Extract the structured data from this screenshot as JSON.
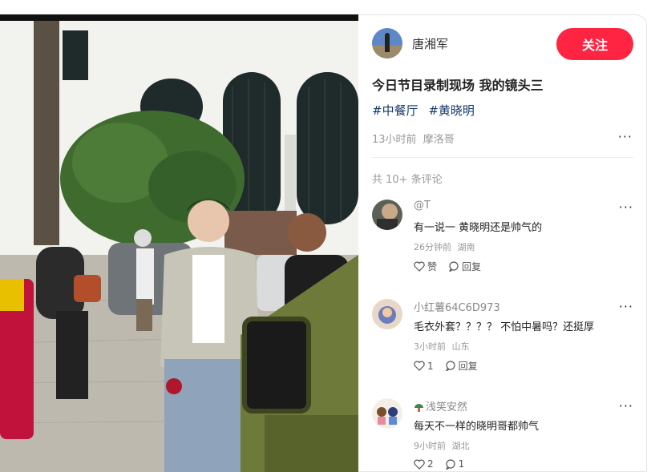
{
  "post": {
    "author_name": "唐湘军",
    "follow_label": "关注",
    "title": "今日节目录制现场 我的镜头三",
    "tags": [
      "#中餐厅",
      "#黄晓明"
    ],
    "time": "13小时前",
    "location": "摩洛哥",
    "more_label": "···"
  },
  "comments_section": {
    "count_label": "共 10+ 条评论"
  },
  "comments": [
    {
      "name": "@T",
      "text": "有一说一 黄晓明还是帅气的",
      "time": "26分钟前",
      "location": "湖南",
      "like_label": "赞",
      "reply_label": "回复",
      "more_label": "···"
    },
    {
      "name": "小红薯64C6D973",
      "text": "毛衣外套？？？？ 不怕中暑吗？还挺厚",
      "time": "3小时前",
      "location": "山东",
      "like_label": "1",
      "reply_label": "回复",
      "more_label": "···"
    },
    {
      "name": "浅笑安然",
      "text": "每天不一样的晓明哥都帅气",
      "time": "9小时前",
      "location": "湖北",
      "like_label": "2",
      "reply_label": "1",
      "more_label": "···"
    }
  ],
  "icons": {
    "like": "heart-icon",
    "reply": "chat-bubble-icon",
    "more": "ellipsis-icon"
  },
  "colors": {
    "follow_button": "#ff2442",
    "tag": "#13386c",
    "muted_text": "#999999"
  }
}
